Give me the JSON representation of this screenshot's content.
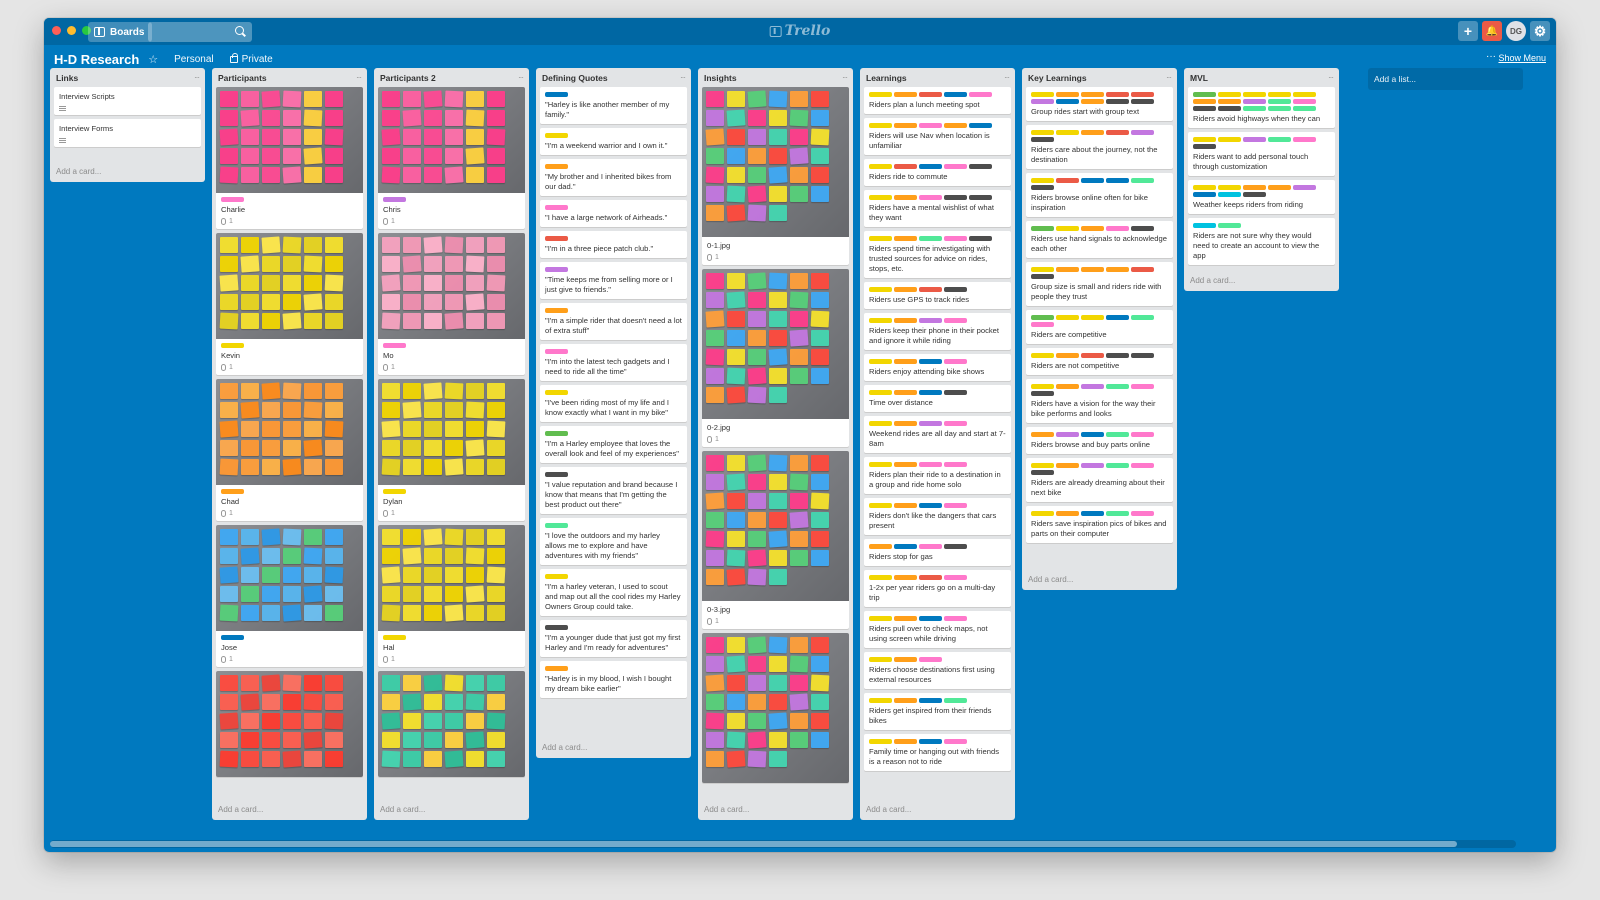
{
  "app": {
    "logo": "Trello",
    "boards_label": "Boards",
    "search_placeholder": ""
  },
  "board": {
    "title": "H-D Research",
    "visibility_team": "Personal",
    "visibility": "Private",
    "show_menu": "Show Menu",
    "add_list": "Add a list..."
  },
  "user": {
    "initials": "DG"
  },
  "colors": {
    "green": "#61bd4f",
    "yellow": "#f2d600",
    "orange": "#ff9f1a",
    "red": "#eb5a46",
    "purple": "#c377e0",
    "blue": "#0079bf",
    "sky": "#00c2e0",
    "lime": "#51e898",
    "pink": "#ff78cb",
    "black": "#4d4d4d"
  },
  "lists": [
    {
      "title": "Links",
      "add_card": "Add a card...",
      "cards": [
        {
          "text": "Interview Scripts",
          "labels": [],
          "desc": true
        },
        {
          "text": "Interview Forms",
          "labels": [],
          "desc": true
        }
      ]
    },
    {
      "title": "Participants",
      "add_card": "Add a card...",
      "cards": [
        {
          "text": "Charlie",
          "labels": [
            "pink"
          ],
          "attachments": "1",
          "photo": "pink"
        },
        {
          "text": "Kevin",
          "labels": [
            "yellow"
          ],
          "attachments": "1",
          "photo": "yellow"
        },
        {
          "text": "Chad",
          "labels": [
            "orange"
          ],
          "attachments": "1",
          "photo": "orange"
        },
        {
          "text": "Jose",
          "labels": [
            "blue"
          ],
          "attachments": "1",
          "photo": "sky"
        },
        {
          "text": "",
          "labels": [],
          "photo": "red"
        }
      ]
    },
    {
      "title": "Participants 2",
      "add_card": "Add a card...",
      "cards": [
        {
          "text": "Chris",
          "labels": [
            "purple"
          ],
          "attachments": "1",
          "photo": "pink"
        },
        {
          "text": "Mo",
          "labels": [
            "pink"
          ],
          "attachments": "1",
          "photo": "pinklight"
        },
        {
          "text": "Dylan",
          "labels": [
            "yellow"
          ],
          "attachments": "1",
          "photo": "yellow"
        },
        {
          "text": "Hal",
          "labels": [
            "yellow"
          ],
          "attachments": "1",
          "photo": "yellow"
        },
        {
          "text": "",
          "labels": [],
          "photo": "teal"
        }
      ]
    },
    {
      "title": "Defining Quotes",
      "add_card": "Add a card...",
      "cards": [
        {
          "text": "\"Harley is like another member of my family.\"",
          "labels": [
            "blue"
          ]
        },
        {
          "text": "\"I'm a weekend warrior and I own it.\"",
          "labels": [
            "yellow"
          ]
        },
        {
          "text": "\"My brother and I inherited bikes from our dad.\"",
          "labels": [
            "orange"
          ]
        },
        {
          "text": "\"I have a large network of Airheads.\"",
          "labels": [
            "pink"
          ]
        },
        {
          "text": "\"I'm in a three piece patch club.\"",
          "labels": [
            "red"
          ]
        },
        {
          "text": "\"Time keeps me from selling more or I just give to friends.\"",
          "labels": [
            "purple"
          ]
        },
        {
          "text": "\"I'm a simple rider that doesn't need a lot of extra stuff\"",
          "labels": [
            "orange"
          ]
        },
        {
          "text": "\"I'm into the latest tech gadgets and I need to ride all the time\"",
          "labels": [
            "pink"
          ]
        },
        {
          "text": "\"I've been riding most of my life and I know exactly what I want in my bike\"",
          "labels": [
            "yellow"
          ]
        },
        {
          "text": "\"I'm a Harley employee that loves the overall look and feel of my experiences\"",
          "labels": [
            "green"
          ]
        },
        {
          "text": "\"I value reputation and brand because I know that means that I'm getting the best product out there\"",
          "labels": [
            "black"
          ]
        },
        {
          "text": "\"I love the outdoors and my harley allows me to explore and have adventures with my friends\"",
          "labels": [
            "lime"
          ]
        },
        {
          "text": "\"I'm a harley veteran, I used to scout and map out all the cool rides my Harley Owners Group could take.",
          "labels": [
            "yellow"
          ]
        },
        {
          "text": "\"I'm a younger dude that just got my first Harley and I'm ready for adventures\"",
          "labels": [
            "black"
          ]
        },
        {
          "text": "\"Harley is in my blood, I wish I bought my dream bike earlier\"",
          "labels": [
            "orange"
          ]
        }
      ]
    },
    {
      "title": "Insights",
      "add_card": "Add a card...",
      "cards": [
        {
          "text": "0-1.jpg",
          "labels": [],
          "attachments": "1",
          "photo": "mixed"
        },
        {
          "text": "0-2.jpg",
          "labels": [],
          "attachments": "1",
          "photo": "mixed"
        },
        {
          "text": "0-3.jpg",
          "labels": [],
          "attachments": "1",
          "photo": "mixed"
        },
        {
          "text": "",
          "labels": [],
          "photo": "mixed"
        }
      ]
    },
    {
      "title": "Learnings",
      "add_card": "Add a card...",
      "cards": [
        {
          "text": "Riders plan a lunch meeting spot",
          "labels": [
            "yellow",
            "orange",
            "red",
            "blue",
            "pink"
          ]
        },
        {
          "text": "Riders will use Nav when location is unfamiliar",
          "labels": [
            "yellow",
            "orange",
            "pink",
            "orange",
            "blue"
          ]
        },
        {
          "text": "Riders ride to commute",
          "labels": [
            "yellow",
            "red",
            "blue",
            "pink",
            "black"
          ]
        },
        {
          "text": "Riders have a mental wishlist of what they want",
          "labels": [
            "yellow",
            "orange",
            "pink",
            "black",
            "black"
          ]
        },
        {
          "text": "Riders spend time investigating with trusted sources for advice on rides, stops, etc.",
          "labels": [
            "yellow",
            "orange",
            "lime",
            "pink",
            "black"
          ]
        },
        {
          "text": "Riders use GPS to track rides",
          "labels": [
            "yellow",
            "orange",
            "red",
            "black"
          ]
        },
        {
          "text": "Riders keep their phone in their pocket and ignore it while riding",
          "labels": [
            "yellow",
            "orange",
            "purple",
            "pink"
          ]
        },
        {
          "text": "Riders enjoy attending bike shows",
          "labels": [
            "yellow",
            "orange",
            "blue",
            "pink"
          ]
        },
        {
          "text": "Time over distance",
          "labels": [
            "yellow",
            "orange",
            "blue",
            "black"
          ]
        },
        {
          "text": "Weekend rides are all day and start at 7-8am",
          "labels": [
            "yellow",
            "orange",
            "purple",
            "pink"
          ]
        },
        {
          "text": "Riders plan their ride to a destination in a group and ride home solo",
          "labels": [
            "yellow",
            "orange",
            "pink",
            "pink"
          ]
        },
        {
          "text": "Riders don't like the dangers that cars present",
          "labels": [
            "yellow",
            "orange",
            "blue",
            "pink"
          ]
        },
        {
          "text": "Riders stop for gas",
          "labels": [
            "orange",
            "blue",
            "pink",
            "black"
          ]
        },
        {
          "text": "1-2x per year riders go on a multi-day trip",
          "labels": [
            "yellow",
            "orange",
            "red",
            "pink"
          ]
        },
        {
          "text": "Riders pull over to check maps, not using screen while driving",
          "labels": [
            "yellow",
            "orange",
            "blue",
            "pink"
          ]
        },
        {
          "text": "Riders choose destinations first using external resources",
          "labels": [
            "yellow",
            "orange",
            "pink"
          ]
        },
        {
          "text": "Riders get inspired from their friends bikes",
          "labels": [
            "yellow",
            "orange",
            "blue",
            "lime"
          ]
        },
        {
          "text": "Family time or hanging out with friends is a reason not to ride",
          "labels": [
            "yellow",
            "orange",
            "blue",
            "pink"
          ]
        }
      ]
    },
    {
      "title": "Key Learnings",
      "add_card": "Add a card...",
      "cards": [
        {
          "text": "Group rides start with group text",
          "labels": [
            "yellow",
            "orange",
            "orange",
            "red",
            "red",
            "purple",
            "blue",
            "orange",
            "black",
            "black"
          ]
        },
        {
          "text": "Riders care about the journey, not the destination",
          "labels": [
            "yellow",
            "yellow",
            "orange",
            "red",
            "purple",
            "black"
          ]
        },
        {
          "text": "Riders browse online often for bike inspiration",
          "labels": [
            "yellow",
            "red",
            "blue",
            "blue",
            "lime",
            "black"
          ]
        },
        {
          "text": "Riders use hand signals to acknowledge each other",
          "labels": [
            "green",
            "yellow",
            "orange",
            "pink",
            "black"
          ]
        },
        {
          "text": "Group size is small and riders ride with people they trust",
          "labels": [
            "yellow",
            "orange",
            "orange",
            "orange",
            "red",
            "black"
          ]
        },
        {
          "text": "Riders are competitive",
          "labels": [
            "green",
            "yellow",
            "yellow",
            "blue",
            "lime",
            "pink"
          ]
        },
        {
          "text": "Riders are not competitive",
          "labels": [
            "yellow",
            "orange",
            "red",
            "black",
            "black"
          ]
        },
        {
          "text": "Riders have a vision for the way their bike performs and looks",
          "labels": [
            "yellow",
            "orange",
            "purple",
            "lime",
            "pink",
            "black"
          ]
        },
        {
          "text": "Riders browse and buy parts online",
          "labels": [
            "orange",
            "purple",
            "blue",
            "lime",
            "pink"
          ]
        },
        {
          "text": "Riders are already dreaming about their next bike",
          "labels": [
            "yellow",
            "orange",
            "purple",
            "lime",
            "pink",
            "black"
          ]
        },
        {
          "text": "Riders save inspiration pics of bikes and parts on their computer",
          "labels": [
            "yellow",
            "orange",
            "blue",
            "lime",
            "pink"
          ]
        }
      ]
    },
    {
      "title": "MVL",
      "add_card": "Add a card...",
      "cards": [
        {
          "text": "Riders avoid highways when they can",
          "labels": [
            "green",
            "yellow",
            "yellow",
            "yellow",
            "yellow",
            "orange",
            "orange",
            "purple",
            "lime",
            "pink",
            "black",
            "black",
            "lime",
            "lime",
            "lime"
          ]
        },
        {
          "text": "Riders want to add personal touch through customization",
          "labels": [
            "yellow",
            "yellow",
            "purple",
            "lime",
            "pink",
            "black"
          ]
        },
        {
          "text": "Weather keeps riders from riding",
          "labels": [
            "yellow",
            "yellow",
            "orange",
            "orange",
            "purple",
            "blue",
            "sky",
            "black"
          ]
        },
        {
          "text": "Riders are not sure why they would need to create an account to view the app",
          "labels": [
            "sky",
            "lime"
          ]
        }
      ]
    }
  ]
}
